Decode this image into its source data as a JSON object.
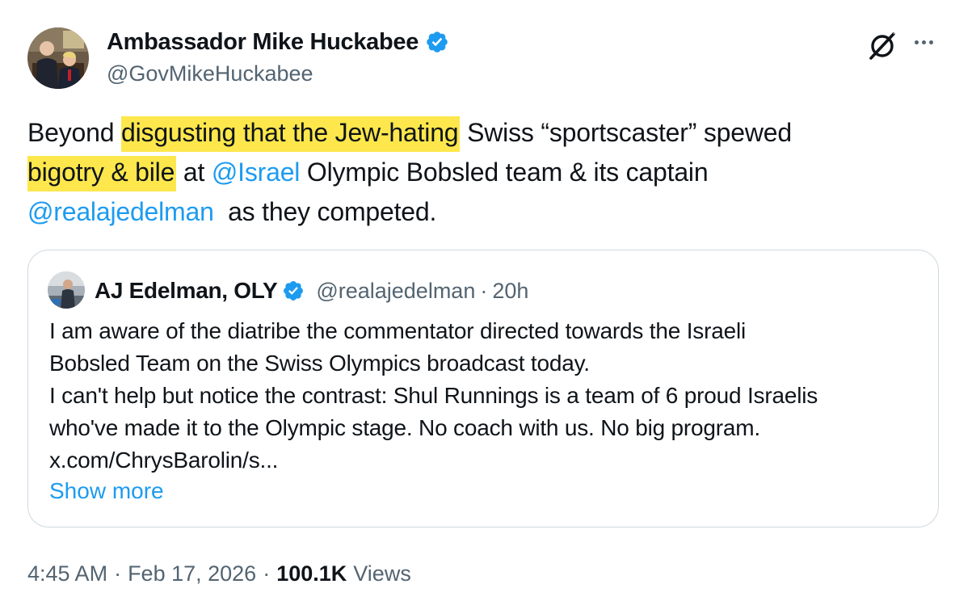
{
  "author": {
    "display_name": "Ambassador Mike Huckabee",
    "handle": "@GovMikeHuckabee",
    "verified_icon": "verified-badge-icon",
    "accent": "#1d9bf0"
  },
  "post": {
    "text_plain_1": "Beyond ",
    "highlight_1": "disgusting that the Jew-hating",
    "text_plain_2": " Swiss “sportscaster” spewed ",
    "highlight_2": "bigotry & bile",
    "text_plain_3": " at ",
    "mention_1": "@Israel",
    "text_plain_4": " Olympic Bobsled team & its captain ",
    "mention_2": "@realajedelman",
    "text_plain_5": "  as they competed.",
    "highlight_color": "#fde74c"
  },
  "quote": {
    "display_name": "AJ Edelman, OLY",
    "handle": "@realajedelman",
    "separator": "·",
    "time": "20h",
    "lines": [
      "I am aware of the diatribe the commentator directed towards the Israeli",
      "Bobsled Team on the Swiss Olympics broadcast today.",
      "I can't help but notice the contrast: Shul Runnings is a team of 6 proud Israelis",
      "who've made it to the Olympic stage. No coach with us. No big program.",
      "x.com/ChrysBarolin/s..."
    ],
    "show_more": "Show more"
  },
  "meta": {
    "time": "4:45 AM",
    "sep1": "·",
    "date": "Feb 17, 2026",
    "sep2": "·",
    "views_count": "100.1K",
    "views_label": "Views"
  },
  "icons": {
    "grok": "grok-icon",
    "more": "more-options-icon"
  }
}
